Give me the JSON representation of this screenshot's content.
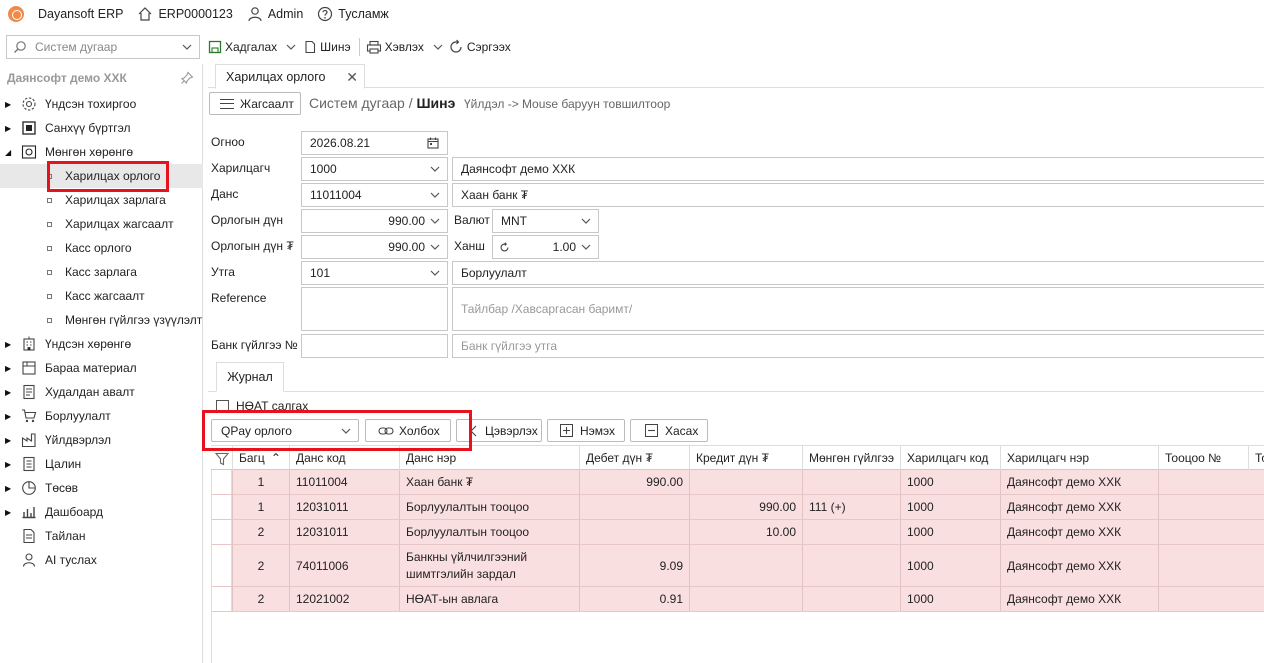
{
  "topbar": {
    "app_name": "Dayansoft ERP",
    "record_no": "ERP0000123",
    "user": "Admin",
    "help": "Тусламж"
  },
  "search": {
    "placeholder": "Систем дугаар"
  },
  "toolbar": {
    "save": "Хадгалах",
    "new": "Шинэ",
    "print": "Хэвлэх",
    "refresh": "Сэргээх"
  },
  "sidebar": {
    "company": "Даянсофт демо ХХК",
    "items": [
      {
        "label": "Үндсэн тохиргоо",
        "icon": "gear-icon"
      },
      {
        "label": "Санхүү бүртгэл",
        "icon": "ledger-icon"
      },
      {
        "label": "Мөнгөн хөрөнгө",
        "icon": "cash-icon"
      },
      {
        "label": "Харилцах орлого",
        "sub": true,
        "active": true
      },
      {
        "label": "Харилцах зарлага",
        "sub": true
      },
      {
        "label": "Харилцах жагсаалт",
        "sub": true
      },
      {
        "label": "Касс орлого",
        "sub": true
      },
      {
        "label": "Касс зарлага",
        "sub": true
      },
      {
        "label": "Касс жагсаалт",
        "sub": true
      },
      {
        "label": "Мөнгөн гүйлгээ үзүүлэлт",
        "sub": true
      },
      {
        "label": "Үндсэн хөрөнгө",
        "icon": "building-icon"
      },
      {
        "label": "Бараа материал",
        "icon": "box-icon"
      },
      {
        "label": "Худалдан авалт",
        "icon": "purchase-icon"
      },
      {
        "label": "Борлуулалт",
        "icon": "cart-icon"
      },
      {
        "label": "Үйлдвэрлэл",
        "icon": "factory-icon"
      },
      {
        "label": "Цалин",
        "icon": "payroll-icon"
      },
      {
        "label": "Төсөв",
        "icon": "pie-icon"
      },
      {
        "label": "Дашбоард",
        "icon": "dashboard-icon"
      },
      {
        "label": "Тайлан",
        "icon": "report-icon"
      },
      {
        "label": "AI туслах",
        "icon": "ai-icon"
      }
    ]
  },
  "tab": {
    "title": "Харилцах орлого"
  },
  "header": {
    "list_button": "Жагсаалт",
    "crumb_prefix": "Систем дугаар /",
    "crumb_current": "Шинэ",
    "hint": "Үйлдэл -> Mouse баруун товшилтоор"
  },
  "form": {
    "date_label": "Огноо",
    "date_value": "2026.08.21",
    "partner_label": "Харилцагч",
    "partner_code": "1000",
    "partner_name": "Даянсофт демо ХХК",
    "account_label": "Данс",
    "account_code": "11011004",
    "account_name": "Хаан банк ₮",
    "amount_label": "Орлогын дүн",
    "amount_value": "990.00",
    "currency_label": "Валют",
    "currency_value": "MNT",
    "amount_mnt_label": "Орлогын дүн ₮",
    "amount_mnt_value": "990.00",
    "rate_label": "Ханш",
    "rate_value": "1.00",
    "purpose_label": "Утга",
    "purpose_code": "101",
    "purpose_name": "Борлуулалт",
    "reference_label": "Reference",
    "note_placeholder": "Тайлбар /Хавсаргасан баримт/",
    "bank_txn_label": "Банк гүйлгээ №",
    "bank_txn_placeholder": "Банк гүйлгээ утга"
  },
  "journal": {
    "tab": "Журнал",
    "vat_label": "НӨАТ салгах",
    "qpay_select": "QPay орлого",
    "link_button": "Холбох",
    "clear_button": "Цэвэрлэх",
    "add_button": "Нэмэх",
    "remove_button": "Хасах",
    "columns": [
      "Багц",
      "Данс код",
      "Данс нэр",
      "Дебет дүн ₮",
      "Кредит дүн ₮",
      "Мөнгөн гүйлгээ",
      "Харилцагч код",
      "Харилцагч нэр",
      "Тооцоо №",
      "То"
    ],
    "rows": [
      [
        "1",
        "11011004",
        "Хаан банк ₮",
        "990.00",
        "",
        "",
        "1000",
        "Даянсофт демо ХХК",
        ""
      ],
      [
        "1",
        "12031011",
        "Борлуулалтын тооцоо",
        "",
        "990.00",
        "111 (+)",
        "1000",
        "Даянсофт демо ХХК",
        ""
      ],
      [
        "2",
        "12031011",
        "Борлуулалтын тооцоо",
        "",
        "10.00",
        "",
        "1000",
        "Даянсофт демо ХХК",
        ""
      ],
      [
        "2",
        "74011006",
        "Банкны үйлчилгээний шимтгэлийн зардал",
        "9.09",
        "",
        "",
        "1000",
        "Даянсофт демо ХХК",
        ""
      ],
      [
        "2",
        "12021002",
        "НӨАТ-ын авлага",
        "0.91",
        "",
        "",
        "1000",
        "Даянсофт демо ХХК",
        ""
      ]
    ]
  },
  "colors": {
    "highlight": "#e8121f",
    "row_bg": "#fadfe0",
    "logo": "#f08a4b"
  }
}
